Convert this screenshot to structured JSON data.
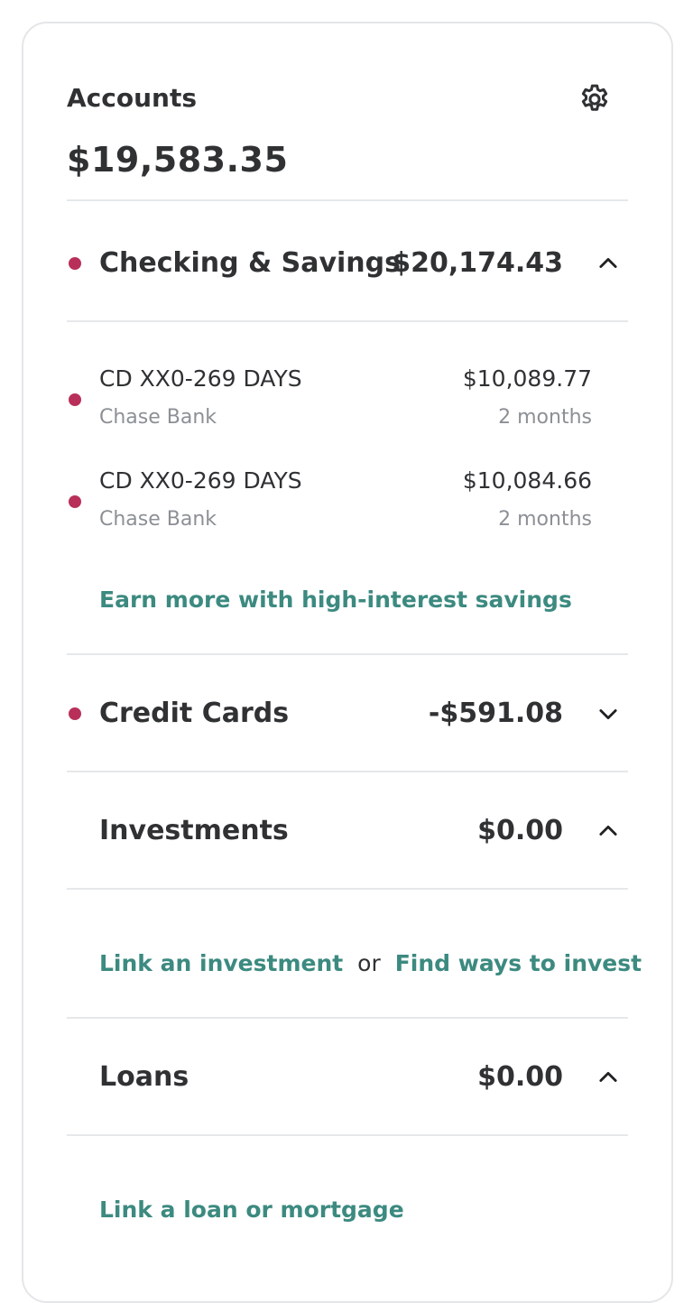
{
  "header": {
    "title": "Accounts",
    "total": "$19,583.35",
    "settings_icon": "gear-icon"
  },
  "sections": {
    "checking": {
      "name": "Checking & Savings",
      "amount": "$20,174.43",
      "expanded": true,
      "accounts": [
        {
          "name": "CD XX0-269 DAYS",
          "institution": "Chase Bank",
          "amount": "$10,089.77",
          "age": "2 months"
        },
        {
          "name": "CD XX0-269 DAYS",
          "institution": "Chase Bank",
          "amount": "$10,084.66",
          "age": "2 months"
        }
      ],
      "promo_link": "Earn more with high-interest savings"
    },
    "credit": {
      "name": "Credit Cards",
      "amount": "-$591.08",
      "expanded": false
    },
    "investments": {
      "name": "Investments",
      "amount": "$0.00",
      "expanded": true,
      "link_primary": "Link an investment",
      "separator": "or",
      "link_secondary": "Find ways to invest"
    },
    "loans": {
      "name": "Loans",
      "amount": "$0.00",
      "expanded": true,
      "link": "Link a loan or mortgage"
    }
  },
  "colors": {
    "accent_link": "#3c8a80",
    "status_dot": "#b8305a",
    "text": "#2f3133",
    "muted": "#8c9095"
  }
}
